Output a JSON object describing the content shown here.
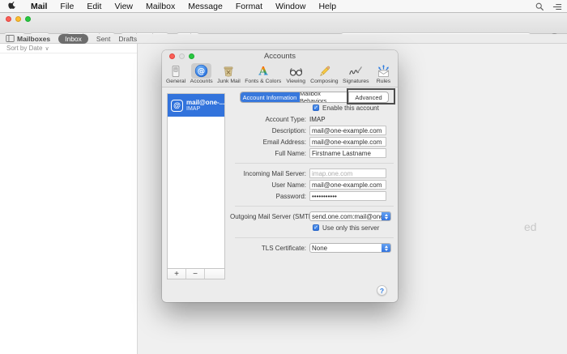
{
  "menu_bar": {
    "items": [
      "Mail",
      "File",
      "Edit",
      "View",
      "Mailbox",
      "Message",
      "Format",
      "Window",
      "Help"
    ]
  },
  "main_toolbar": {
    "search_placeholder": "Search"
  },
  "favorites_bar": {
    "mailboxes": "Mailboxes",
    "inbox": "Inbox",
    "sent": "Sent",
    "drafts": "Drafts",
    "selected": "Inbox"
  },
  "message_list": {
    "sort_label": "Sort by Date"
  },
  "watermark": {
    "text": "ed"
  },
  "prefs": {
    "title": "Accounts",
    "toolbar": {
      "items": [
        {
          "label": "General",
          "icon": "general-icon"
        },
        {
          "label": "Accounts",
          "icon": "accounts-icon"
        },
        {
          "label": "Junk Mail",
          "icon": "junk-mail-icon"
        },
        {
          "label": "Fonts & Colors",
          "icon": "fonts-colors-icon"
        },
        {
          "label": "Viewing",
          "icon": "viewing-icon"
        },
        {
          "label": "Composing",
          "icon": "composing-icon"
        },
        {
          "label": "Signatures",
          "icon": "signatures-icon"
        },
        {
          "label": "Rules",
          "icon": "rules-icon"
        }
      ],
      "selected": "Accounts"
    },
    "account_list": {
      "items": [
        {
          "name": "mail@one-...",
          "protocol": "IMAP",
          "badge": "@"
        }
      ],
      "selected_index": 0
    },
    "tabs": {
      "items": [
        "Account Information",
        "Mailbox Behaviors",
        "Advanced"
      ],
      "selected": "Account Information",
      "annotated": "Advanced"
    },
    "form": {
      "enable": {
        "label": "Enable this account",
        "checked": true
      },
      "account_type": {
        "label": "Account Type:",
        "value": "IMAP"
      },
      "description": {
        "label": "Description:",
        "value": "mail@one-example.com"
      },
      "email": {
        "label": "Email Address:",
        "value": "mail@one-example.com"
      },
      "full_name": {
        "label": "Full Name:",
        "value": "Firstname Lastname"
      },
      "incoming": {
        "label": "Incoming Mail Server:",
        "value": "imap.one.com",
        "disabled": true
      },
      "user_name": {
        "label": "User Name:",
        "value": "mail@one-example.com"
      },
      "password": {
        "label": "Password:",
        "value": "•••••••••••"
      },
      "smtp": {
        "label": "Outgoing Mail Server (SMTP):",
        "value": "send.one.com:mail@one-exam"
      },
      "use_only": {
        "label": "Use only this server",
        "checked": true
      },
      "tls": {
        "label": "TLS Certificate:",
        "value": "None"
      }
    },
    "buttons": {
      "add": "+",
      "remove": "−",
      "help": "?"
    }
  },
  "glyphs": {
    "check": "✓",
    "at": "@",
    "sort_chevron": "∨",
    "clear_x": "✕"
  },
  "colors": {
    "accent_blue": "#3273dc",
    "selected_tab_blue": "#3878dc",
    "flag_red": "#ed6a5e",
    "annotation_gray": "#4d4d4d"
  }
}
